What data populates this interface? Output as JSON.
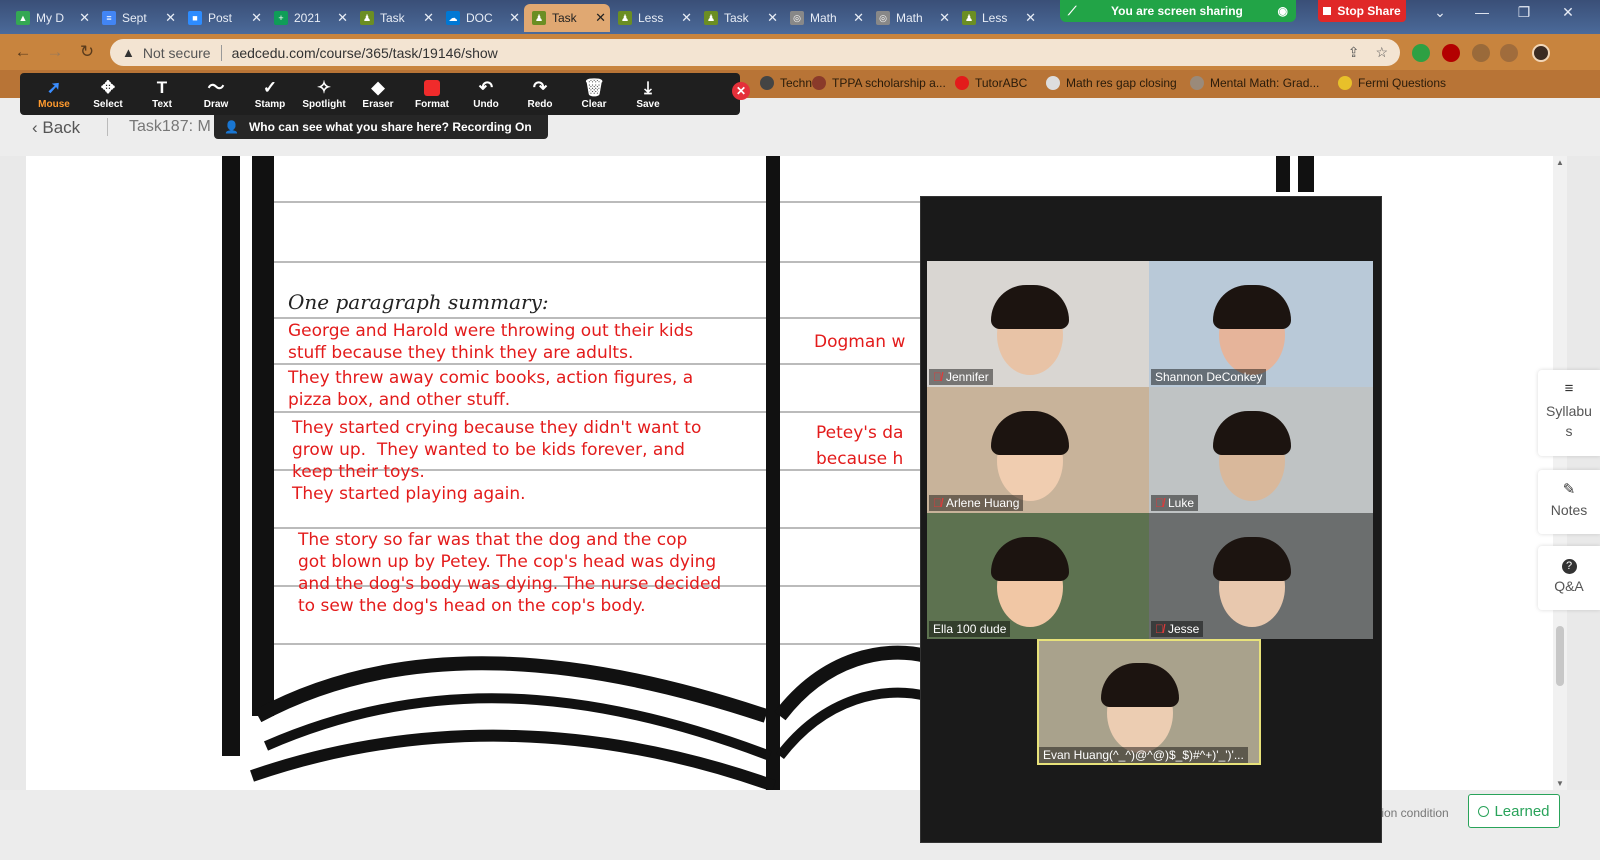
{
  "browser": {
    "tabs": [
      {
        "label": "My D",
        "color": "#34a853",
        "glyph": "▲"
      },
      {
        "label": "Sept",
        "color": "#4285f4",
        "glyph": "≡"
      },
      {
        "label": "Post",
        "color": "#2d8cff",
        "glyph": "■"
      },
      {
        "label": "2021",
        "color": "#0f9d58",
        "glyph": "+"
      },
      {
        "label": "Task",
        "color": "#6b8e23",
        "glyph": "♟"
      },
      {
        "label": "DOC",
        "color": "#0078d4",
        "glyph": "☁"
      },
      {
        "label": "Task",
        "color": "#6b8e23",
        "glyph": "♟"
      },
      {
        "label": "Less",
        "color": "#6b8e23",
        "glyph": "♟"
      },
      {
        "label": "Task",
        "color": "#6b8e23",
        "glyph": "♟"
      },
      {
        "label": "Math",
        "color": "#888888",
        "glyph": "◎"
      },
      {
        "label": "Math",
        "color": "#888888",
        "glyph": "◎"
      },
      {
        "label": "Less",
        "color": "#6b8e23",
        "glyph": "♟"
      }
    ],
    "active_tab_index": 6,
    "sharing_label": "You are screen sharing",
    "stop_share_label": "Stop Share",
    "security_label": "Not secure",
    "url": "aedcedu.com/course/365/task/19146/show",
    "bookmarks": [
      {
        "label": "Techn...",
        "color": "#444444"
      },
      {
        "label": "TPPA scholarship a...",
        "color": "#8a3a2a"
      },
      {
        "label": "TutorABC",
        "color": "#e31b1b"
      },
      {
        "label": "Math res gap closing",
        "color": "#dddddd"
      },
      {
        "label": "Mental Math: Grad...",
        "color": "#9a8a7a"
      },
      {
        "label": "Fermi Questions",
        "color": "#e8c02a"
      }
    ]
  },
  "zoom_toolbar": {
    "tools": [
      {
        "label": "Mouse",
        "icon": "cursor-icon",
        "glyph": "➚"
      },
      {
        "label": "Select",
        "icon": "move-icon",
        "glyph": "✥"
      },
      {
        "label": "Text",
        "icon": "text-icon",
        "glyph": "T"
      },
      {
        "label": "Draw",
        "icon": "draw-icon",
        "glyph": "〜"
      },
      {
        "label": "Stamp",
        "icon": "check-icon",
        "glyph": "✓"
      },
      {
        "label": "Spotlight",
        "icon": "wand-icon",
        "glyph": "✧"
      },
      {
        "label": "Eraser",
        "icon": "eraser-icon",
        "glyph": "◆"
      },
      {
        "label": "Format",
        "icon": "format-icon",
        "glyph": ""
      },
      {
        "label": "Undo",
        "icon": "undo-icon",
        "glyph": "↶"
      },
      {
        "label": "Redo",
        "icon": "redo-icon",
        "glyph": "↷"
      },
      {
        "label": "Clear",
        "icon": "trash-icon",
        "glyph": "🗑"
      },
      {
        "label": "Save",
        "icon": "save-icon",
        "glyph": "⤓"
      }
    ],
    "selected_tool": "Mouse",
    "recording_banner": "Who can see what you share here? Recording On"
  },
  "page": {
    "back_label": "Back",
    "task_title": "Task187:  M",
    "summary_heading": "One paragraph summary:",
    "notes_left": [
      "George and Harold were throwing out their kids\nstuff because they think they are adults.",
      "They threw away comic books, action figures, a\npizza box, and other stuff.",
      "They started crying because they didn't want to\ngrow up.  They wanted to be kids forever, and\nkeep their toys.\nThey started playing again.",
      "The story so far was that the dog and the cop\ngot blown up by Petey. The cop's head was dying\nand the dog's body was dying. The nurse decided\nto sew the dog's head on the cop's body."
    ],
    "notes_right": [
      "Dogman w",
      "Petey's da\nbecause h"
    ],
    "side_buttons": [
      {
        "label": "Syllabu\ns",
        "icon": "menu-icon",
        "glyph": "≡"
      },
      {
        "label": "Notes",
        "icon": "pencil-icon",
        "glyph": "✎"
      },
      {
        "label": "Q&A",
        "icon": "question-icon",
        "glyph": "?"
      }
    ],
    "condition_text": "tion condition",
    "learned_label": "Learned"
  },
  "participants": [
    {
      "name": "Jennifer",
      "muted": true,
      "bg": "#d9d6d2",
      "skin": "#e8c3a6"
    },
    {
      "name": "Shannon DeConkey",
      "muted": false,
      "bg": "#b9c9d8",
      "skin": "#e6b49a"
    },
    {
      "name": "Arlene Huang",
      "muted": true,
      "bg": "#c8b39a",
      "skin": "#f0cdb0"
    },
    {
      "name": "Luke",
      "muted": true,
      "bg": "#bfc3c4",
      "skin": "#d9b89b"
    },
    {
      "name": "Ella 100 dude",
      "muted": false,
      "bg": "#5d7250",
      "skin": "#f1c7a5"
    },
    {
      "name": "Jesse",
      "muted": true,
      "bg": "#6b6e6e",
      "skin": "#e8c8ae"
    },
    {
      "name": "Evan Huang(^_^)@^@)$_$)#^+)'_')'...",
      "muted": false,
      "bg": "#a9a28c",
      "skin": "#eccdb2",
      "active": true
    }
  ]
}
